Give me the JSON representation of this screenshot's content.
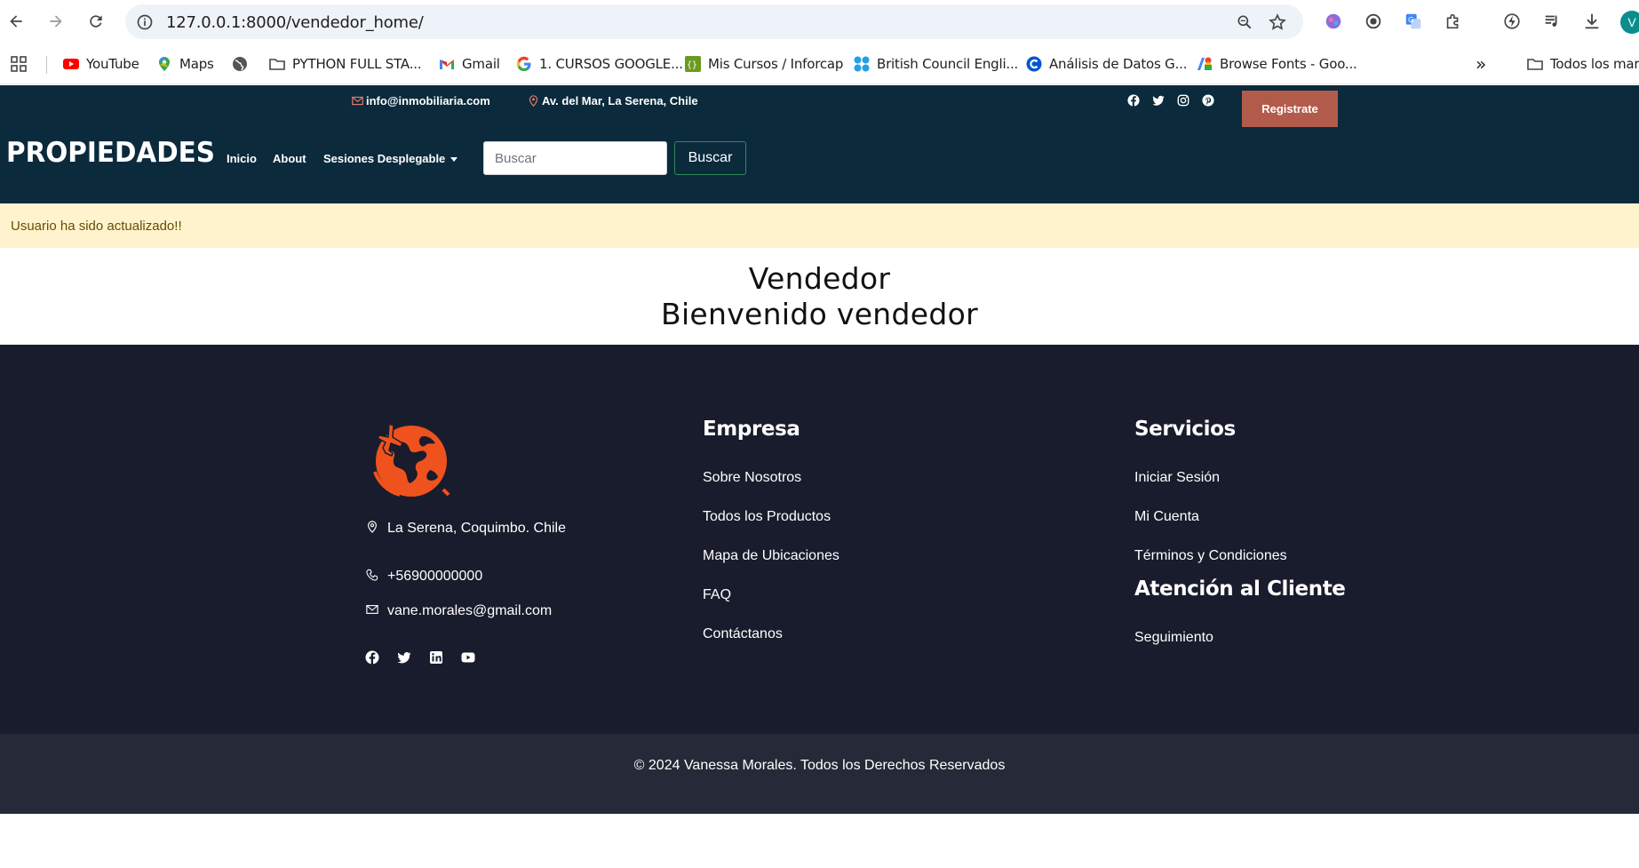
{
  "browser": {
    "url": "127.0.0.1:8000/vendedor_home/",
    "profile_initial": "V",
    "bookmarks": [
      {
        "label": "YouTube",
        "icon": "youtube-icon"
      },
      {
        "label": "Maps",
        "icon": "maps-pin-icon"
      },
      {
        "label": "",
        "icon": "globe-icon"
      },
      {
        "label": "PYTHON FULL STA...",
        "icon": "folder-icon"
      },
      {
        "label": "Gmail",
        "icon": "gmail-icon"
      },
      {
        "label": "1. CURSOS GOOGLE...",
        "icon": "google-icon"
      },
      {
        "label": "Mis Cursos / Inforcap",
        "icon": "inforcap-icon"
      },
      {
        "label": "British Council Engli...",
        "icon": "british-council-icon"
      },
      {
        "label": "Análisis de Datos G...",
        "icon": "coursera-icon"
      },
      {
        "label": "Browse Fonts - Goo...",
        "icon": "google-fonts-icon"
      }
    ],
    "more_bookmarks": "»",
    "all_bookmarks": "Todos los marcadores"
  },
  "header": {
    "email": "info@inmobiliaria.com",
    "address": "Av. del Mar, La Serena, Chile",
    "register_label": "Registrate",
    "brand": "PROPIEDADES",
    "nav": {
      "home": "Inicio",
      "about": "About",
      "dropdown": "Sesiones Desplegable"
    },
    "search": {
      "placeholder": "Buscar",
      "button_label": "Buscar"
    }
  },
  "alert": {
    "message": "Usuario ha sido actualizado!!"
  },
  "main": {
    "title": "Vendedor",
    "subtitle": "Bienvenido vendedor"
  },
  "footer": {
    "location": "La Serena, Coquimbo. Chile",
    "phone": "+56900000000",
    "email": "vane.morales@gmail.com",
    "empresa": {
      "title": "Empresa",
      "links": [
        "Sobre Nosotros",
        "Todos los Productos",
        "Mapa de Ubicaciones",
        "FAQ",
        "Contáctanos"
      ]
    },
    "servicios": {
      "title": "Servicios",
      "links": [
        "Iniciar Sesión",
        "Mi Cuenta",
        "Términos y Condiciones"
      ]
    },
    "atencion": {
      "title": "Atención al Cliente",
      "links": [
        "Seguimiento"
      ]
    },
    "copyright": "© 2024 Vanessa Morales. Todos los Derechos Reservados"
  },
  "colors": {
    "header_bg": "#0b2a3c",
    "register_bg": "#b35b4a",
    "alert_bg": "#fff3cd",
    "footer_bg": "#191c2c",
    "copyright_bg": "#262937",
    "accent_orange": "#f0521e"
  }
}
